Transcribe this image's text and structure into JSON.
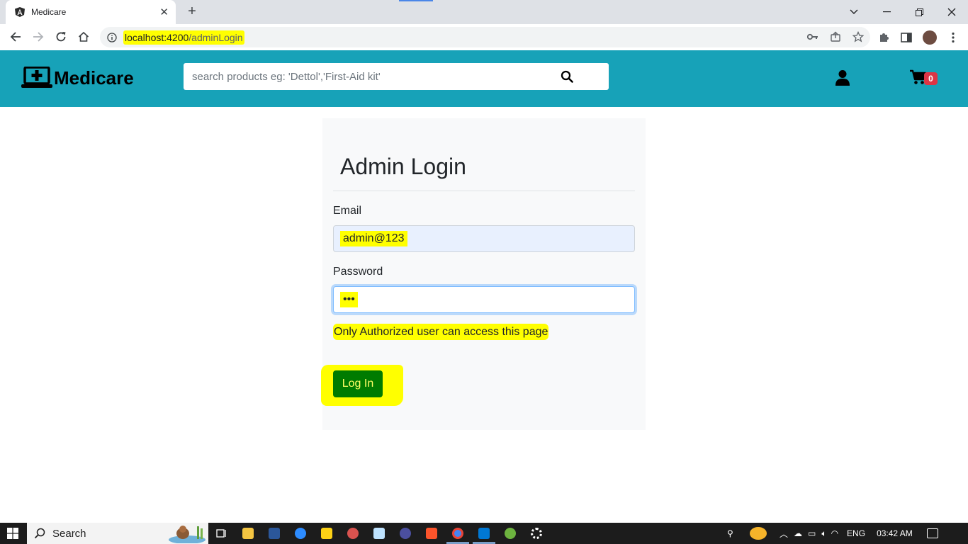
{
  "browser": {
    "tab_title": "Medicare",
    "new_tab_label": "+",
    "url_host": "localhost:4200",
    "url_path": "/adminLogin"
  },
  "header": {
    "brand": "Medicare",
    "search_placeholder": "search products eg: 'Dettol','First-Aid kit'",
    "cart_count": "0"
  },
  "login": {
    "title": "Admin Login",
    "email_label": "Email",
    "email_value": "admin@123",
    "password_label": "Password",
    "password_value": "•••",
    "notice": "Only Authorized user can access this page",
    "login_button": "Log In"
  },
  "taskbar": {
    "search_label": "Search",
    "language": "ENG",
    "time": "03:42 AM"
  },
  "colors": {
    "header_bg": "#17a2b8",
    "highlight": "#ffff00",
    "login_button": "#007b00",
    "badge": "#dc3545"
  }
}
